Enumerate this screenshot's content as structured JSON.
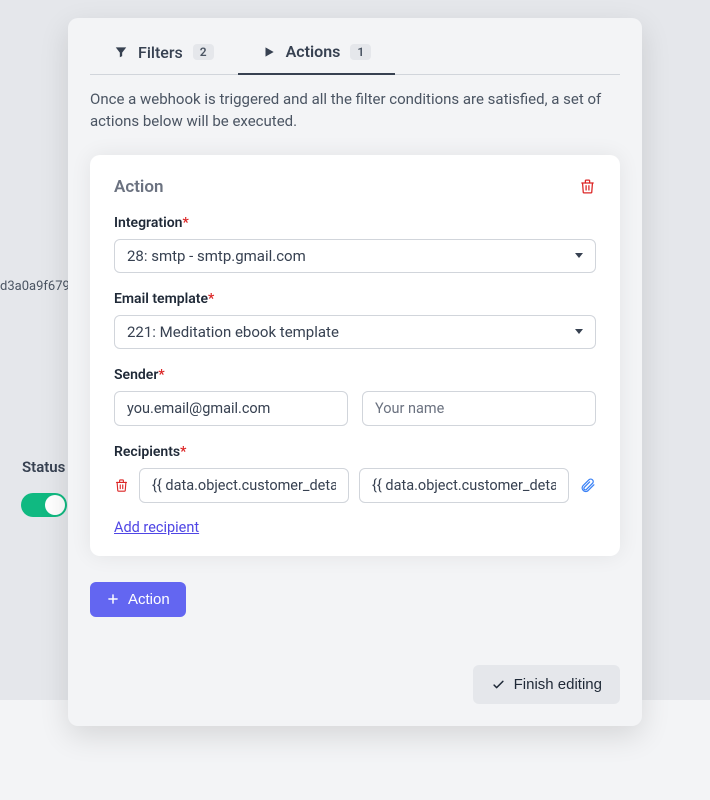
{
  "background": {
    "truncated_id": "d3a0a9f679",
    "status_label": "Status"
  },
  "tabs": {
    "filters": {
      "label": "Filters",
      "count": "2"
    },
    "actions": {
      "label": "Actions",
      "count": "1"
    }
  },
  "description": "Once a webhook is triggered and all the filter conditions are satisfied, a set of actions below will be executed.",
  "action": {
    "title": "Action",
    "integration_label": "Integration",
    "integration_value": "28: smtp - smtp.gmail.com",
    "template_label": "Email template",
    "template_value": "221: Meditation ebook template",
    "sender_label": "Sender",
    "sender_email": "you.email@gmail.com",
    "sender_name_placeholder": "Your name",
    "recipients_label": "Recipients",
    "recipient_email": "{{ data.object.customer_details.email }}",
    "recipient_name": "{{ data.object.customer_details.name }}",
    "add_recipient": "Add recipient"
  },
  "buttons": {
    "add_action": "Action",
    "finish": "Finish editing"
  }
}
